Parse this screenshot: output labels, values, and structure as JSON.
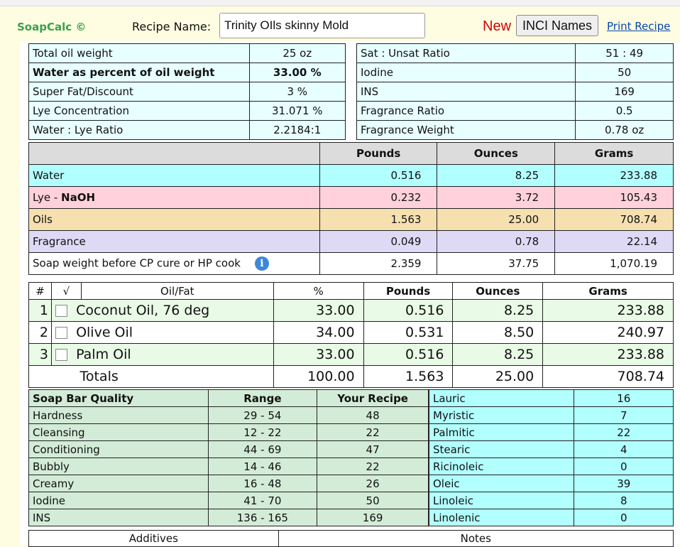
{
  "header": {
    "brand": "SoapCalc ©",
    "recipe_name_label": "Recipe Name:",
    "recipe_name_value": "Trinity OIls skinny Mold",
    "new_label": "New",
    "inci_button": "INCI Names",
    "print_link": "Print Recipe"
  },
  "summary_left": [
    {
      "label": "Total oil weight",
      "value": "25 oz",
      "bold": false
    },
    {
      "label": "Water as percent of oil weight",
      "value": "33.00 %",
      "bold": true
    },
    {
      "label": "Super Fat/Discount",
      "value": "3 %",
      "bold": false
    },
    {
      "label": "Lye Concentration",
      "value": "31.071 %",
      "bold": false
    },
    {
      "label": "Water : Lye Ratio",
      "value": "2.2184:1",
      "bold": false
    }
  ],
  "summary_right": [
    {
      "label": "Sat : Unsat Ratio",
      "value": "51 : 49"
    },
    {
      "label": "Iodine",
      "value": "50"
    },
    {
      "label": "INS",
      "value": "169"
    },
    {
      "label": "Fragrance Ratio",
      "value": "0.5"
    },
    {
      "label": "Fragrance Weight",
      "value": "0.78 oz"
    }
  ],
  "weights": {
    "headers": [
      "Pounds",
      "Ounces",
      "Grams"
    ],
    "rows": [
      {
        "label": "Water",
        "pounds": "0.516",
        "ounces": "8.25",
        "grams": "233.88"
      },
      {
        "label_prefix": "Lye - ",
        "label_bold": "NaOH",
        "pounds": "0.232",
        "ounces": "3.72",
        "grams": "105.43"
      },
      {
        "label": "Oils",
        "pounds": "1.563",
        "ounces": "25.00",
        "grams": "708.74"
      },
      {
        "label": "Fragrance",
        "pounds": "0.049",
        "ounces": "0.78",
        "grams": "22.14"
      },
      {
        "label": "Soap weight before CP cure or HP cook",
        "pounds": "2.359",
        "ounces": "37.75",
        "grams": "1,070.19"
      }
    ]
  },
  "oils": {
    "headers": [
      "#",
      "√",
      "Oil/Fat",
      "%",
      "Pounds",
      "Ounces",
      "Grams"
    ],
    "rows": [
      {
        "num": "1",
        "name": "Coconut Oil, 76 deg",
        "pct": "33.00",
        "pounds": "0.516",
        "ounces": "8.25",
        "grams": "233.88"
      },
      {
        "num": "2",
        "name": "Olive Oil",
        "pct": "34.00",
        "pounds": "0.531",
        "ounces": "8.50",
        "grams": "240.97"
      },
      {
        "num": "3",
        "name": "Palm Oil",
        "pct": "33.00",
        "pounds": "0.516",
        "ounces": "8.25",
        "grams": "233.88"
      }
    ],
    "totals": {
      "label": "Totals",
      "pct": "100.00",
      "pounds": "1.563",
      "ounces": "25.00",
      "grams": "708.74"
    }
  },
  "quality": {
    "headers": [
      "Soap Bar Quality",
      "Range",
      "Your Recipe"
    ],
    "rows": [
      {
        "name": "Hardness",
        "range": "29 - 54",
        "value": "48"
      },
      {
        "name": "Cleansing",
        "range": "12 - 22",
        "value": "22"
      },
      {
        "name": "Conditioning",
        "range": "44 - 69",
        "value": "47"
      },
      {
        "name": "Bubbly",
        "range": "14 - 46",
        "value": "22"
      },
      {
        "name": "Creamy",
        "range": "16 - 48",
        "value": "26"
      },
      {
        "name": "Iodine",
        "range": "41 - 70",
        "value": "50"
      },
      {
        "name": "INS",
        "range": "136 - 165",
        "value": "169"
      }
    ]
  },
  "fatty_acids": [
    {
      "name": "Lauric",
      "value": "16"
    },
    {
      "name": "Myristic",
      "value": "7"
    },
    {
      "name": "Palmitic",
      "value": "22"
    },
    {
      "name": "Stearic",
      "value": "4"
    },
    {
      "name": "Ricinoleic",
      "value": "0"
    },
    {
      "name": "Oleic",
      "value": "39"
    },
    {
      "name": "Linoleic",
      "value": "8"
    },
    {
      "name": "Linolenic",
      "value": "0"
    }
  ],
  "footer": {
    "additives": "Additives",
    "notes": "Notes"
  }
}
